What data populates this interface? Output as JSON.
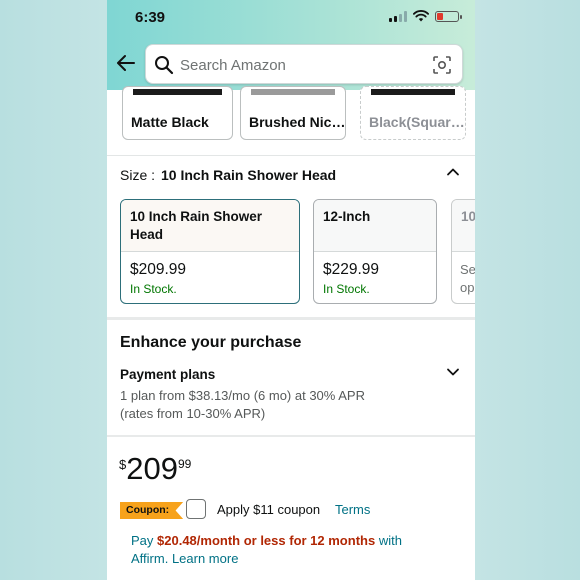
{
  "status_bar": {
    "time": "6:39"
  },
  "search": {
    "placeholder": "Search Amazon"
  },
  "styles": [
    {
      "label": "Matte Black",
      "swatch": "#1b1b1b"
    },
    {
      "label": "Brushed Nic…",
      "swatch": "#9a9a9a"
    },
    {
      "label": "Black(Squar…",
      "swatch": "#1b1b1b"
    }
  ],
  "size": {
    "label": "Size :",
    "selected": "10 Inch Rain Shower Head",
    "options": [
      {
        "name_line1": "10 Inch Rain Shower",
        "name_line2": "Head",
        "price": "$209.99",
        "stock": "In Stock."
      },
      {
        "name_line1": "12-Inch",
        "price": "$229.99",
        "stock": "In Stock."
      },
      {
        "name_line1": "10",
        "line_a": "Se",
        "line_b": "op"
      }
    ]
  },
  "enhance": {
    "title": "Enhance your purchase",
    "payment_title": "Payment plans",
    "plan_line1": "1 plan from $38.13/mo (6 mo) at 30% APR",
    "plan_line2": "(rates from 10-30% APR)"
  },
  "price": {
    "symbol": "$",
    "whole": "209",
    "fraction": "99"
  },
  "coupon": {
    "badge": "Coupon:",
    "text": "Apply $11 coupon",
    "terms": "Terms"
  },
  "affirm": {
    "pay": "Pay ",
    "amount": "$20.48/month or less for 12 months",
    "with": " with",
    "brand": "Affirm.",
    "learn_more": " Learn more"
  },
  "colors": {
    "accent_teal": "#007185",
    "price_red": "#b12704",
    "coupon_orange": "#f7a21b",
    "stock_green": "#007600"
  }
}
